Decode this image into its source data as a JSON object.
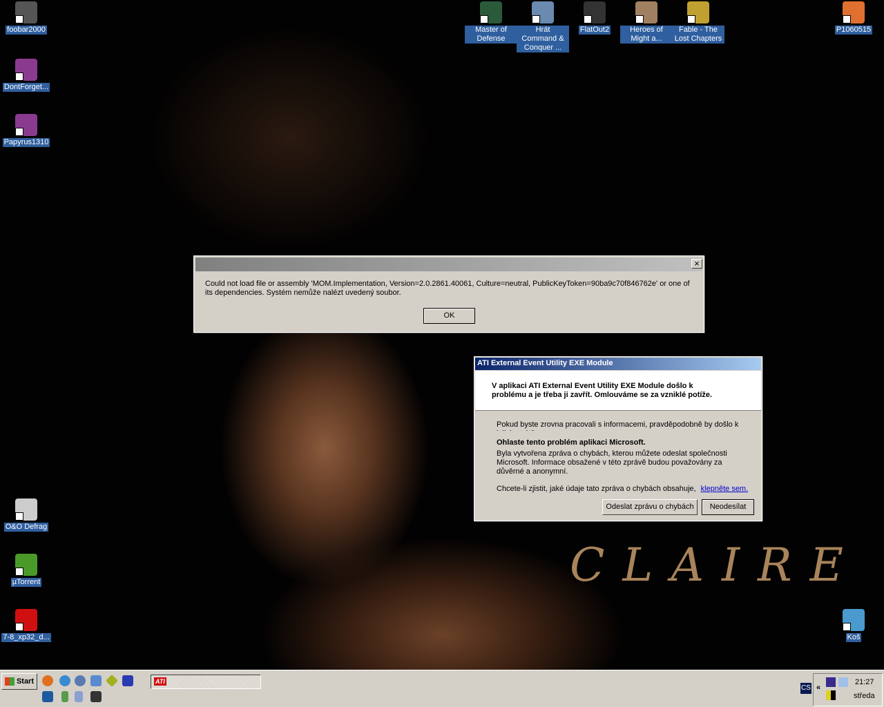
{
  "desktop": {
    "wallpaper_text": "CLAIRE",
    "icons": [
      {
        "label": "foobar2000",
        "color": "#555"
      },
      {
        "label": "DontForget...",
        "color": "#8a3b8f"
      },
      {
        "label": "Papyrus1310",
        "color": "#8a3b8f"
      },
      {
        "label": "O&O Defrag",
        "color": "#ccc"
      },
      {
        "label": "µTorrent",
        "color": "#4a9a2a"
      },
      {
        "label": "7-8_xp32_d...",
        "color": "#d01010"
      },
      {
        "label": "Master of Defense",
        "color": "#2a5a3a"
      },
      {
        "label": "Hrát Command & Conquer ...",
        "color": "#6a8ab0"
      },
      {
        "label": "FlatOut2",
        "color": "#333"
      },
      {
        "label": "Heroes of Might a...",
        "color": "#a08060"
      },
      {
        "label": "Fable - The Lost Chapters",
        "color": "#c0a030"
      },
      {
        "label": "P1060515",
        "color": "#e07030"
      },
      {
        "label": "Koš",
        "color": "#4a9ad0"
      }
    ]
  },
  "error_dialog": {
    "message": "Could not load file or assembly 'MOM.Implementation, Version=2.0.2861.40061, Culture=neutral, PublicKeyToken=90ba9c70f846762e' or one of its dependencies. Systém nemůže nalézt uvedený soubor.",
    "ok": "OK",
    "close": "×"
  },
  "ati_dialog": {
    "title": "ATI External Event Utility EXE Module",
    "heading": "V aplikaci ATI External Event Utility EXE Module došlo k problému a je třeba ji zavřít. Omlouváme se za vzniklé potíže.",
    "info": "Pokud byste zrovna pracovali s informacemi, pravděpodobně by došlo k jejich ztrátě.",
    "report_heading": "Ohlaste tento problém aplikaci Microsoft.",
    "report_text": "Byla vytvořena zpráva o chybách, kterou můžete odeslat společnosti Microsoft. Informace obsažené v této zprávě budou považovány za důvěrné a anonymní.",
    "details_text": "Chcete-li zjistit, jaké údaje tato zpráva o chybách obsahuje,",
    "details_link": "klepněte sem.",
    "send": "Odeslat zprávu o chybách",
    "dont_send": "Neodesílat"
  },
  "taskbar": {
    "start": "Start",
    "task_label": "ATI",
    "lang": "CS",
    "expand": "«",
    "time": "21:27",
    "day": "středa"
  }
}
